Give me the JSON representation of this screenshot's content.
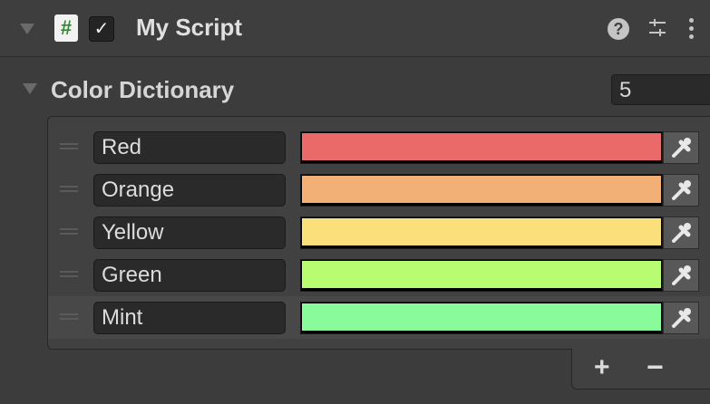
{
  "header": {
    "title": "My Script",
    "script_icon": "#",
    "enabled_check": "✓",
    "help_icon": "?"
  },
  "dictionary": {
    "label": "Color Dictionary",
    "count": "5",
    "items": [
      {
        "key": "Red",
        "color": "#ea6a6a"
      },
      {
        "key": "Orange",
        "color": "#f2b076"
      },
      {
        "key": "Yellow",
        "color": "#fbdf7b"
      },
      {
        "key": "Green",
        "color": "#b8fd71"
      },
      {
        "key": "Mint",
        "color": "#8afb9b"
      }
    ],
    "add_label": "+",
    "remove_label": "−"
  }
}
